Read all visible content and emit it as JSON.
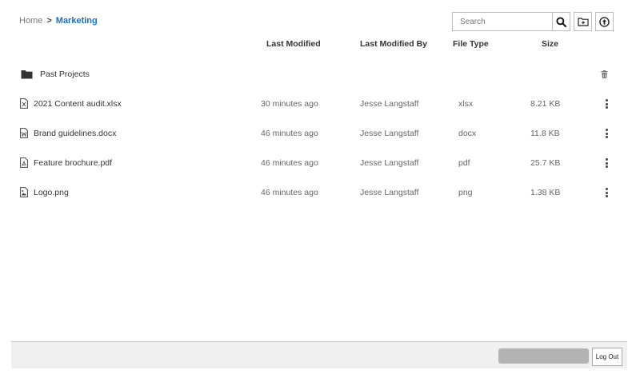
{
  "breadcrumb": {
    "home": "Home",
    "separator": ">",
    "current": "Marketing"
  },
  "search": {
    "placeholder": "Search",
    "value": ""
  },
  "toolbar": {
    "search_icon": "magnifier-icon",
    "new_folder_icon": "folder-plus-icon",
    "upload_icon": "upload-circle-icon"
  },
  "columns": {
    "modified": "Last Modified",
    "by": "Last Modified By",
    "type": "File Type",
    "size": "Size"
  },
  "folder": {
    "name": "Past Projects",
    "icon": "folder-icon",
    "action_icon": "trash-icon"
  },
  "files": [
    {
      "name": "2021 Content audit.xlsx",
      "modified": "30 minutes ago",
      "by": "Jesse Langstaff",
      "type": "xlsx",
      "size": "8.21 KB",
      "icon": "spreadsheet-file-icon"
    },
    {
      "name": "Brand guidelines.docx",
      "modified": "46 minutes ago",
      "by": "Jesse Langstaff",
      "type": "docx",
      "size": "11.8 KB",
      "icon": "word-file-icon"
    },
    {
      "name": "Feature brochure.pdf",
      "modified": "46 minutes ago",
      "by": "Jesse Langstaff",
      "type": "pdf",
      "size": "25.7 KB",
      "icon": "pdf-file-icon"
    },
    {
      "name": "Logo.png",
      "modified": "46 minutes ago",
      "by": "Jesse Langstaff",
      "type": "png",
      "size": "1.38 KB",
      "icon": "image-file-icon"
    }
  ],
  "footer": {
    "logout_label": "Log Out"
  },
  "colors": {
    "accent": "#1a6fc4",
    "footer_bg": "#f0f0f0",
    "progress": "#b3b3b3"
  }
}
